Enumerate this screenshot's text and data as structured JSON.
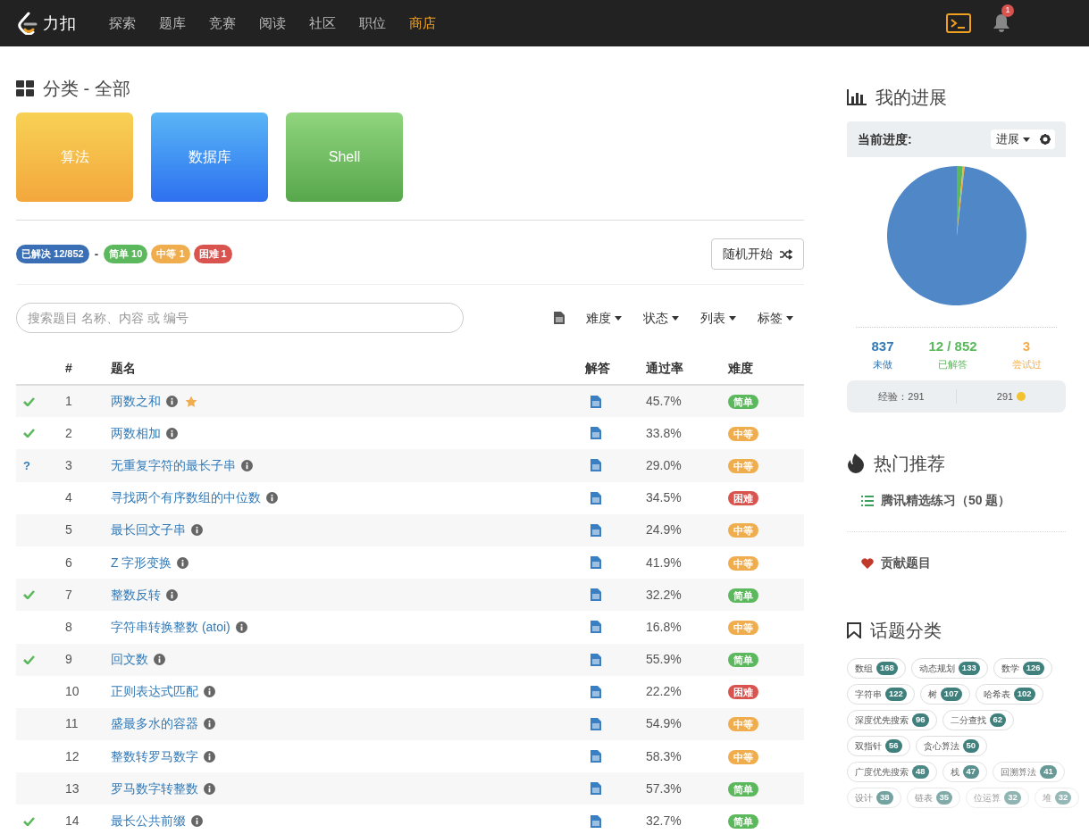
{
  "nav": {
    "brand": "力扣",
    "items": [
      {
        "label": "探索",
        "selected": false
      },
      {
        "label": "题库",
        "selected": false
      },
      {
        "label": "竞赛",
        "selected": false
      },
      {
        "label": "阅读",
        "selected": false
      },
      {
        "label": "社区",
        "selected": false
      },
      {
        "label": "职位",
        "selected": false
      },
      {
        "label": "商店",
        "selected": true
      }
    ],
    "notifications": "1"
  },
  "category": {
    "title": "分类 - 全部",
    "cards": [
      {
        "label": "算法",
        "kind": "algo"
      },
      {
        "label": "数据库",
        "kind": "db"
      },
      {
        "label": "Shell",
        "kind": "shell"
      }
    ]
  },
  "summary": {
    "solved": "已解决 12/852",
    "separator": "-",
    "badges": [
      {
        "label": "简单 10",
        "kind": "easy"
      },
      {
        "label": "中等 1",
        "kind": "medium"
      },
      {
        "label": "困难 1",
        "kind": "hard"
      }
    ],
    "random_button": "随机开始"
  },
  "search": {
    "placeholder": "搜索题目 名称、内容 或 编号"
  },
  "filters": [
    "难度",
    "状态",
    "列表",
    "标签"
  ],
  "table": {
    "columns": [
      "#",
      "题名",
      "解答",
      "通过率",
      "难度"
    ],
    "rows": [
      {
        "kind": "solved",
        "num": "1",
        "title": "两数之和",
        "starred": true,
        "rate": "45.7%",
        "difficulty": {
          "label": "简单",
          "kind": "easy"
        }
      },
      {
        "kind": "solved",
        "num": "2",
        "title": "两数相加",
        "starred": false,
        "rate": "33.8%",
        "difficulty": {
          "label": "中等",
          "kind": "medium"
        }
      },
      {
        "kind": "attempted",
        "mark": "?",
        "num": "3",
        "title": "无重复字符的最长子串",
        "starred": false,
        "rate": "29.0%",
        "difficulty": {
          "label": "中等",
          "kind": "medium"
        }
      },
      {
        "kind": "none",
        "num": "4",
        "title": "寻找两个有序数组的中位数",
        "starred": false,
        "rate": "34.5%",
        "difficulty": {
          "label": "困难",
          "kind": "hard"
        }
      },
      {
        "kind": "none",
        "num": "5",
        "title": "最长回文子串",
        "starred": false,
        "rate": "24.9%",
        "difficulty": {
          "label": "中等",
          "kind": "medium"
        }
      },
      {
        "kind": "none",
        "num": "6",
        "title": "Z 字形变换",
        "starred": false,
        "rate": "41.9%",
        "difficulty": {
          "label": "中等",
          "kind": "medium"
        }
      },
      {
        "kind": "solved",
        "num": "7",
        "title": "整数反转",
        "starred": false,
        "rate": "32.2%",
        "difficulty": {
          "label": "简单",
          "kind": "easy"
        }
      },
      {
        "kind": "none",
        "num": "8",
        "title": "字符串转换整数 (atoi)",
        "starred": false,
        "rate": "16.8%",
        "difficulty": {
          "label": "中等",
          "kind": "medium"
        }
      },
      {
        "kind": "solved",
        "num": "9",
        "title": "回文数",
        "starred": false,
        "rate": "55.9%",
        "difficulty": {
          "label": "简单",
          "kind": "easy"
        }
      },
      {
        "kind": "none",
        "num": "10",
        "title": "正则表达式匹配",
        "starred": false,
        "rate": "22.2%",
        "difficulty": {
          "label": "困难",
          "kind": "hard"
        }
      },
      {
        "kind": "none",
        "num": "11",
        "title": "盛最多水的容器",
        "starred": false,
        "rate": "54.9%",
        "difficulty": {
          "label": "中等",
          "kind": "medium"
        }
      },
      {
        "kind": "none",
        "num": "12",
        "title": "整数转罗马数字",
        "starred": false,
        "rate": "58.3%",
        "difficulty": {
          "label": "中等",
          "kind": "medium"
        }
      },
      {
        "kind": "none",
        "num": "13",
        "title": "罗马数字转整数",
        "starred": false,
        "rate": "57.3%",
        "difficulty": {
          "label": "简单",
          "kind": "easy"
        }
      },
      {
        "kind": "solved",
        "num": "14",
        "title": "最长公共前缀",
        "starred": false,
        "rate": "32.7%",
        "difficulty": {
          "label": "简单",
          "kind": "easy"
        }
      }
    ]
  },
  "progress": {
    "title": "我的进展",
    "current_label": "当前进度:",
    "dropdown": "进展",
    "chart_data": {
      "type": "pie",
      "values": [
        98.2,
        1.4,
        0.4
      ],
      "colors": [
        "#5087c7",
        "#5cb85c",
        "#f0ad4e"
      ]
    },
    "stats": [
      {
        "value": "837",
        "label": "未做",
        "color": "#337ab7"
      },
      {
        "value": "12 / 852",
        "label": "已解答",
        "color": "#5cb85c"
      },
      {
        "value": "3",
        "label": "尝试过",
        "color": "#f0ad4e"
      }
    ],
    "experience": "经验：291",
    "coins": "291"
  },
  "hot": {
    "title": "热门推荐",
    "list_item": "腾讯精选练习（50 题）",
    "contribute": "贡献题目"
  },
  "topics": {
    "title": "话题分类",
    "tags": [
      {
        "name": "数组",
        "count": "168"
      },
      {
        "name": "动态规划",
        "count": "133"
      },
      {
        "name": "数学",
        "count": "126"
      },
      {
        "name": "字符串",
        "count": "122"
      },
      {
        "name": "树",
        "count": "107"
      },
      {
        "name": "哈希表",
        "count": "102"
      },
      {
        "name": "深度优先搜索",
        "count": "96"
      },
      {
        "name": "二分查找",
        "count": "62"
      },
      {
        "name": "双指针",
        "count": "56"
      },
      {
        "name": "贪心算法",
        "count": "50"
      },
      {
        "name": "广度优先搜索",
        "count": "48"
      },
      {
        "name": "栈",
        "count": "47"
      },
      {
        "name": "回溯算法",
        "count": "41"
      },
      {
        "name": "设计",
        "count": "38"
      },
      {
        "name": "链表",
        "count": "35"
      },
      {
        "name": "位运算",
        "count": "32"
      },
      {
        "name": "堆",
        "count": "32"
      }
    ]
  }
}
